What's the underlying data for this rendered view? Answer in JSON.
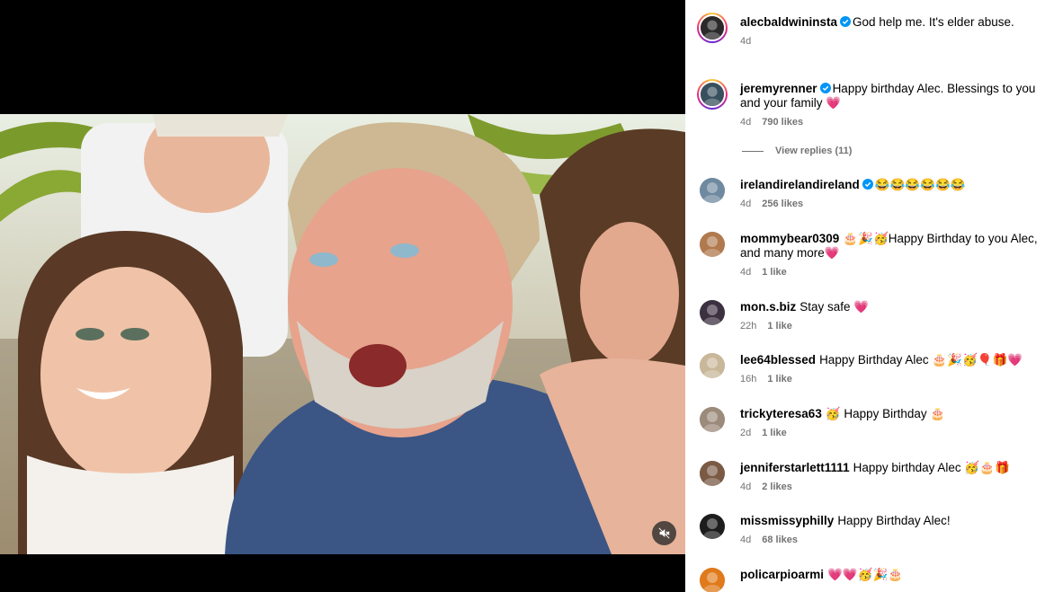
{
  "media": {
    "mute_icon": "speaker-muted-icon"
  },
  "comments": [
    {
      "user": "alecbaldwininsta",
      "verified": true,
      "text": "God help me. It's elder abuse.",
      "time": "4d",
      "likes": "",
      "story": true,
      "avatar_color": "#2a2a2a"
    },
    {
      "user": "jeremyrenner",
      "verified": true,
      "text": "Happy birthday Alec. Blessings to you and your family 💗",
      "time": "4d",
      "likes": "790 likes",
      "story": true,
      "avatar_color": "#38505e"
    },
    {
      "user": "irelandirelandireland",
      "verified": true,
      "text": "😂😂😂😂😂😂",
      "time": "4d",
      "likes": "256 likes",
      "story": false,
      "avatar_color": "#6f8aa0"
    },
    {
      "user": "mommybear0309",
      "verified": false,
      "text": "🎂🎉🥳Happy Birthday to you Alec, and many more💗",
      "time": "4d",
      "likes": "1 like",
      "story": false,
      "avatar_color": "#b07a4e"
    },
    {
      "user": "mon.s.biz",
      "verified": false,
      "text": "Stay safe 💗",
      "time": "22h",
      "likes": "1 like",
      "story": false,
      "avatar_color": "#3b3140"
    },
    {
      "user": "lee64blessed",
      "verified": false,
      "text": "Happy Birthday Alec 🎂🎉🥳🎈🎁💗",
      "time": "16h",
      "likes": "1 like",
      "story": false,
      "avatar_color": "#c9b79a"
    },
    {
      "user": "trickyteresa63",
      "verified": false,
      "text": "🥳 Happy Birthday 🎂",
      "time": "2d",
      "likes": "1 like",
      "story": false,
      "avatar_color": "#9c8a7a"
    },
    {
      "user": "jenniferstarlett1111",
      "verified": false,
      "text": "Happy birthday Alec 🥳🎂🎁",
      "time": "4d",
      "likes": "2 likes",
      "story": false,
      "avatar_color": "#7a5a45"
    },
    {
      "user": "missmissyphilly",
      "verified": false,
      "text": "Happy Birthday Alec!",
      "time": "4d",
      "likes": "68 likes",
      "story": false,
      "avatar_color": "#1d1d1d"
    },
    {
      "user": "policarpioarmi",
      "verified": false,
      "text": "💗💗🥳🎉🎂",
      "time": "",
      "likes": "",
      "story": false,
      "avatar_color": "#e07a1a"
    }
  ],
  "view_replies": "View replies (11)"
}
